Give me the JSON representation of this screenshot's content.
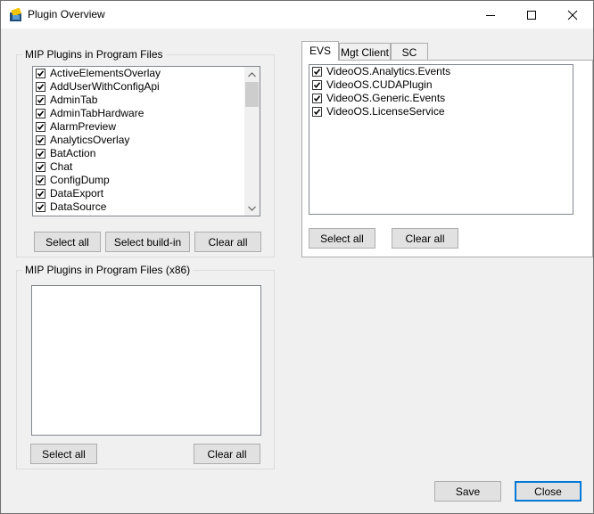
{
  "window": {
    "title": "Plugin Overview",
    "icon": "plugin-app-icon"
  },
  "program_files": {
    "legend": "MIP Plugins in Program Files",
    "items": [
      {
        "label": "ActiveElementsOverlay",
        "checked": true
      },
      {
        "label": "AddUserWithConfigApi",
        "checked": true
      },
      {
        "label": "AdminTab",
        "checked": true
      },
      {
        "label": "AdminTabHardware",
        "checked": true
      },
      {
        "label": "AlarmPreview",
        "checked": true
      },
      {
        "label": "AnalyticsOverlay",
        "checked": true
      },
      {
        "label": "BatAction",
        "checked": true
      },
      {
        "label": "Chat",
        "checked": true
      },
      {
        "label": "ConfigDump",
        "checked": true
      },
      {
        "label": "DataExport",
        "checked": true
      },
      {
        "label": "DataSource",
        "checked": true
      }
    ],
    "select_all": "Select all",
    "select_buildin": "Select build-in",
    "clear_all": "Clear all"
  },
  "program_files_x86": {
    "legend": "MIP Plugins in Program Files (x86)",
    "items": [],
    "select_all": "Select all",
    "clear_all": "Clear all"
  },
  "tabs": {
    "items": [
      {
        "label": "EVS",
        "active": true
      },
      {
        "label": "Mgt Client",
        "active": false
      },
      {
        "label": "SC",
        "active": false
      }
    ],
    "evs_items": [
      {
        "label": "VideoOS.Analytics.Events",
        "checked": true
      },
      {
        "label": "VideoOS.CUDAPlugin",
        "checked": true
      },
      {
        "label": "VideoOS.Generic.Events",
        "checked": true
      },
      {
        "label": "VideoOS.LicenseService",
        "checked": true
      }
    ],
    "select_all": "Select all",
    "clear_all": "Clear all"
  },
  "footer": {
    "save": "Save",
    "close": "Close"
  }
}
